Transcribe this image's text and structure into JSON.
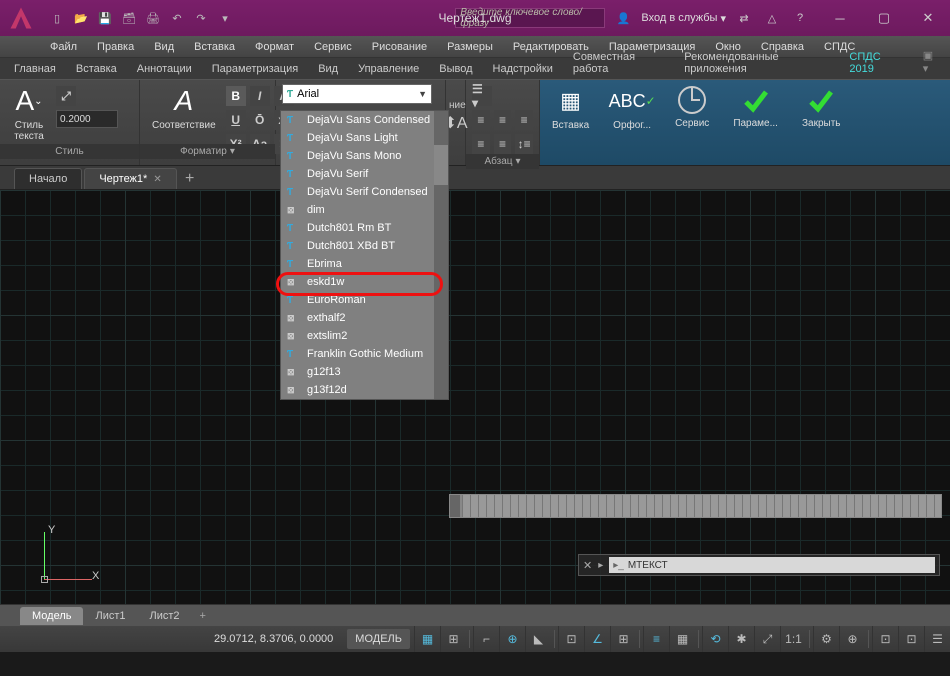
{
  "title": "Чертеж1.dwg",
  "search_placeholder": "Введите ключевое слово/фразу",
  "signin": "Вход в службы",
  "menubar": [
    "Файл",
    "Правка",
    "Вид",
    "Вставка",
    "Формат",
    "Сервис",
    "Рисование",
    "Размеры",
    "Редактировать",
    "Параметризация",
    "Окно",
    "Справка",
    "СПДС"
  ],
  "ribbon_tabs": [
    "Главная",
    "Вставка",
    "Аннотации",
    "Параметризация",
    "Вид",
    "Управление",
    "Вывод",
    "Надстройки",
    "Совместная работа",
    "Рекомендованные приложения",
    "СПДС 2019"
  ],
  "ribbon": {
    "style": {
      "label": "Стиль\nтекста",
      "value": "0.2000",
      "panel": "Стиль"
    },
    "match": {
      "label": "Соответствие"
    },
    "format_panel": "Форматир",
    "font_value": "Arial",
    "paragraph_panel": "Абзац",
    "insert": "Вставка",
    "spell": "Орфог...",
    "tools": "Сервис",
    "options": "Параме...",
    "close": "Закрыть"
  },
  "filetabs": {
    "start": "Начало",
    "doc": "Чертеж1*"
  },
  "fonts": [
    "DejaVu Sans Condensed",
    "DejaVu Sans Light",
    "DejaVu Sans Mono",
    "DejaVu Serif",
    "DejaVu Serif Condensed",
    "dim",
    "Dutch801 Rm BT",
    "Dutch801 XBd BT",
    "Ebrima",
    "eskd1w",
    "EuroRoman",
    "exthalf2",
    "extslim2",
    "Franklin Gothic Medium",
    "g12f13",
    "g13f12d"
  ],
  "font_types": [
    "tt",
    "tt",
    "tt",
    "tt",
    "tt",
    "shx",
    "tt",
    "tt",
    "tt",
    "shx",
    "tt",
    "shx",
    "shx",
    "tt",
    "shx",
    "shx"
  ],
  "cmd_prompt": "МТЕКСТ",
  "layouts": {
    "model": "Модель",
    "l1": "Лист1",
    "l2": "Лист2"
  },
  "status": {
    "coords": "29.0712, 8.3706, 0.0000",
    "model": "МОДЕЛЬ",
    "scale": "1:1"
  },
  "ucs": {
    "x": "X",
    "y": "Y"
  },
  "ribbon_hidden": "ние"
}
